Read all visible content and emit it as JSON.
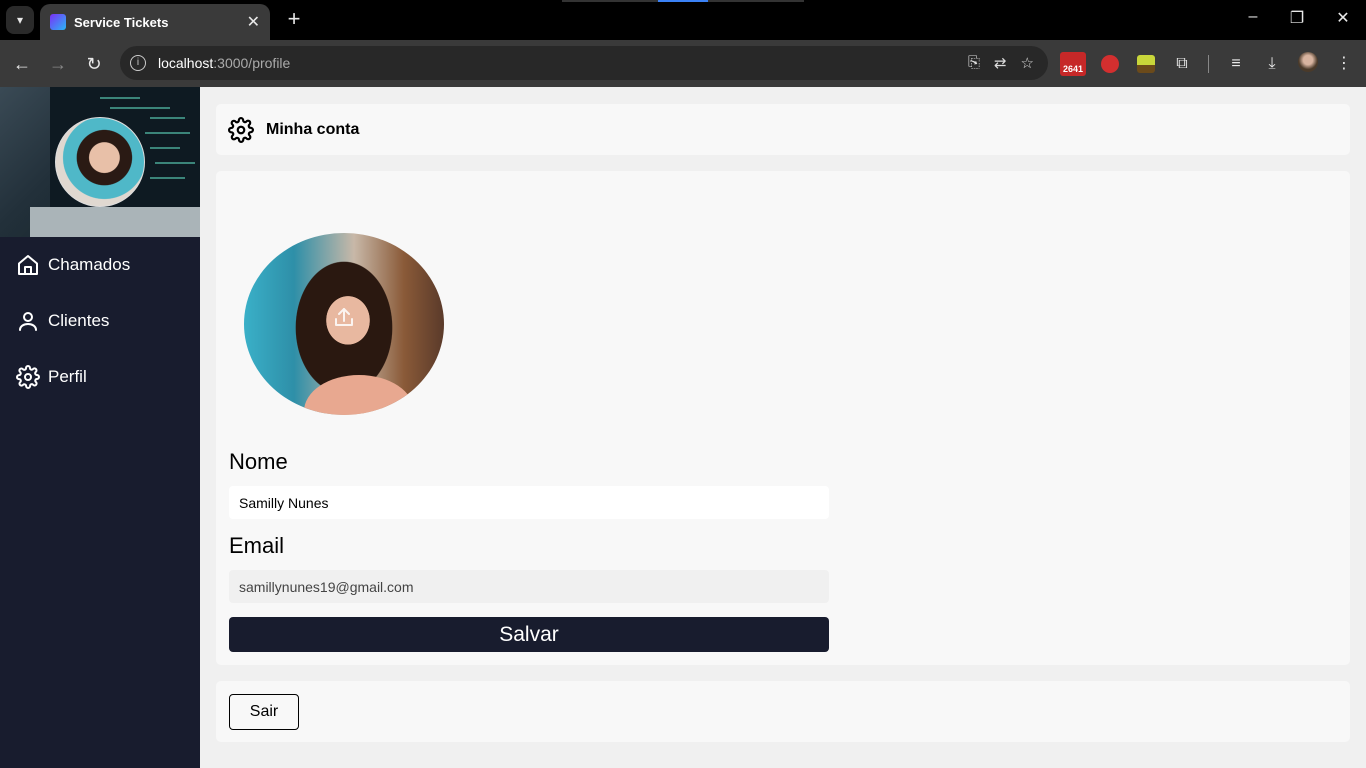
{
  "browser": {
    "tab_title": "Service Tickets",
    "url_host": "localhost",
    "url_path": ":3000/profile",
    "extension_badge": "2641"
  },
  "sidebar": {
    "items": [
      {
        "label": "Chamados",
        "icon": "home-icon"
      },
      {
        "label": "Clientes",
        "icon": "user-icon"
      },
      {
        "label": "Perfil",
        "icon": "gear-icon"
      }
    ]
  },
  "header": {
    "title": "Minha conta"
  },
  "form": {
    "name_label": "Nome",
    "name_value": "Samilly Nunes",
    "email_label": "Email",
    "email_value": "samillynunes19@gmail.com",
    "save_label": "Salvar"
  },
  "logout": {
    "label": "Sair"
  },
  "colors": {
    "sidebar_bg": "#181c2e",
    "primary_button": "#181c2e",
    "card_bg": "#f8f8f8"
  }
}
